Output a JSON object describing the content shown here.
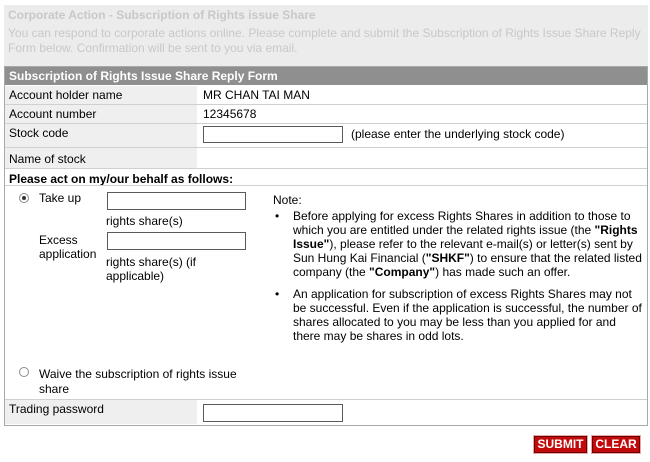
{
  "banner": {
    "title": "Corporate Action - Subscription of Rights issue Share",
    "text": "You can respond to corporate actions online. Please complete and submit the Subscription of Rights Issue Share Reply Form below. Confirmation will be sent to you via email."
  },
  "form": {
    "header": "Subscription of Rights Issue Share Reply Form",
    "account_holder_label": "Account holder name",
    "account_holder_value": "MR CHAN TAI MAN",
    "account_number_label": "Account number",
    "account_number_value": "12345678",
    "stock_code_label": "Stock code",
    "stock_code_value": "",
    "stock_code_hint": "(please enter the underlying stock code)",
    "stock_name_label": "Name of stock",
    "stock_name_value": "",
    "act_title": "Please act on my/our behalf as follows:",
    "take_up_label": "Take up",
    "take_up_value": "",
    "take_up_unit": "rights share(s)",
    "excess_label_1": "Excess",
    "excess_label_2": "application",
    "excess_value": "",
    "excess_unit_1": "rights share(s) (if",
    "excess_unit_2": "applicable)",
    "waive_label_1": "Waive the subscription of rights issue",
    "waive_label_2": "share",
    "selected_option": "take_up",
    "trading_password_label": "Trading password",
    "trading_password_value": ""
  },
  "note": {
    "title": "Note:",
    "item1_a": "Before applying for excess Rights Shares in addition to those to which you are entitled under the related rights issue (the ",
    "item1_b": "\"Rights Issue\"",
    "item1_c": "), please refer to the relevant e-mail(s) or letter(s) sent by Sun Hung Kai Financial (",
    "item1_d": "\"SHKF\"",
    "item1_e": ") to ensure that the related listed company (the ",
    "item1_f": "\"Company\"",
    "item1_g": ") has made such an offer.",
    "item2": "An application for subscription of excess Rights Shares may not be successful. Even if the application is successful, the number of shares allocated to you may be less than you applied for and there may be shares in odd lots."
  },
  "buttons": {
    "submit": "SUBMIT",
    "clear": "CLEAR"
  },
  "colors": {
    "header_bg": "#8f8f8f",
    "label_bg": "#efefef",
    "button_red": "#c20a0a"
  }
}
